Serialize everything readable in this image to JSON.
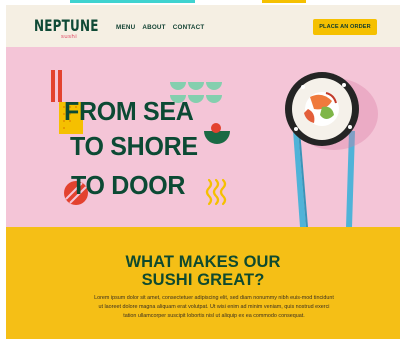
{
  "brand": {
    "name": "NEPTUNE",
    "tagline": "sushi"
  },
  "nav": {
    "items": [
      "MENU",
      "ABOUT",
      "CONTACT"
    ]
  },
  "header": {
    "cta_label": "PLACE AN ORDER"
  },
  "hero": {
    "lines": [
      "FROM SEA",
      "TO SHORE",
      "TO DOOR"
    ]
  },
  "feature": {
    "title_line1": "WHAT MAKES OUR",
    "title_line2": "SUSHI GREAT?",
    "body": "Lorem ipsum dolor sit amet, consectetuer adipiscing elit, sed diam nonummy nibh euis-mod tincidunt ut laoreet dolore magna aliquam erat volutpat. Ut wisi enim ad minim veniam, quis nostrud exerci tation ullamcorper suscipit lobortis nisl ut aliquip ex ea commodo consequat."
  },
  "colors": {
    "header_bg": "#f5efe3",
    "hero_bg": "#f4c5d7",
    "brand_green": "#0f4a36",
    "accent_yellow": "#f5c000",
    "accent_red": "#e3422f",
    "accent_mint": "#84cfae",
    "chopstick_blue": "#4fb3d8"
  },
  "icons": [
    "red-stripes-decoration",
    "mint-wave-decoration",
    "red-stripe-ball-decoration",
    "yellow-squiggle-decoration",
    "sushi-roll-image",
    "chopsticks-image"
  ]
}
